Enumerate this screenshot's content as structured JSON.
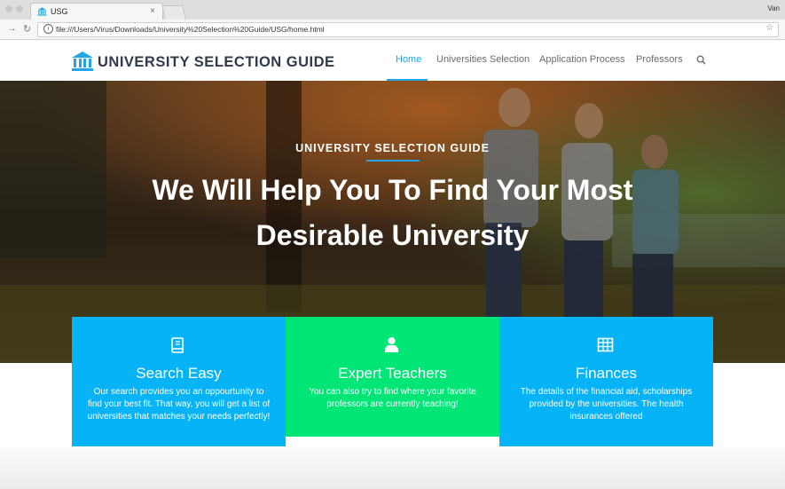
{
  "browser": {
    "tab_title": "USG",
    "tab_close": "×",
    "profile": "Van",
    "url": "file:///Users/Virus/Downloads/University%20Selection%20Guide/USG/home.html",
    "info_glyph": "i",
    "star_glyph": "☆"
  },
  "site": {
    "brand": "UNIVERSITY SELECTION GUIDE",
    "menu": [
      {
        "label": "Home",
        "active": true
      },
      {
        "label": "Universities Selection"
      },
      {
        "label": "Application Process"
      },
      {
        "label": "Professors"
      }
    ]
  },
  "hero": {
    "subtitle": "UNIVERSITY SELECTION GUIDE",
    "heading": "We Will Help You To Find Your Most Desirable University"
  },
  "features": [
    {
      "title": "Search Easy",
      "description": "Our search provides you an oppourtunity to find your best fit. That way, you will get a list of universities that matches your needs perfectly!",
      "icon": "book-icon",
      "color": "#06b3f6"
    },
    {
      "title": "Expert Teachers",
      "description": "You can also try to find where your favorite professors are currently teaching!",
      "icon": "user-icon",
      "color": "#00e676"
    },
    {
      "title": "Finances",
      "description": "The details of the financial aid, scholarships provided by the universities. The health insurances offered",
      "icon": "table-icon",
      "color": "#06b3f6"
    }
  ],
  "colors": {
    "accent": "#21a5e8",
    "brand_text": "#2f3b4a"
  }
}
